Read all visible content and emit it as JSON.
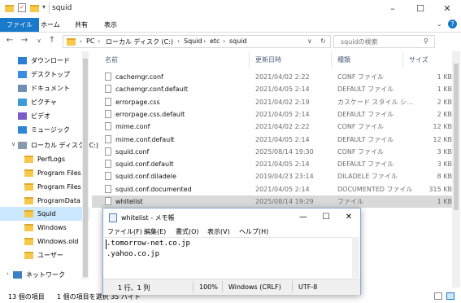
{
  "window": {
    "title": "squid",
    "controls": {
      "minimize": "–",
      "maximize": "☐",
      "close": "✕"
    },
    "help": "?"
  },
  "ribbon": {
    "tabs": [
      "ファイル",
      "ホーム",
      "共有",
      "表示"
    ]
  },
  "address": {
    "crumbs": [
      "PC",
      "ローカル ディスク (C:)",
      "Squid",
      "etc",
      "squid"
    ],
    "search_placeholder": "squidの検索"
  },
  "sidebar": {
    "items": [
      {
        "label": "ダウンロード",
        "icon": "download-icon"
      },
      {
        "label": "デスクトップ",
        "icon": "desktop-icon"
      },
      {
        "label": "ドキュメント",
        "icon": "documents-icon"
      },
      {
        "label": "ピクチャ",
        "icon": "pictures-icon"
      },
      {
        "label": "ビデオ",
        "icon": "video-icon"
      },
      {
        "label": "ミュージック",
        "icon": "music-icon"
      },
      {
        "label": "ローカル ディスク (C:)",
        "icon": "drive-icon"
      },
      {
        "label": "PerfLogs",
        "icon": "folder-icon"
      },
      {
        "label": "Program Files",
        "icon": "folder-icon"
      },
      {
        "label": "Program Files (",
        "icon": "folder-icon"
      },
      {
        "label": "ProgramData",
        "icon": "folder-icon"
      },
      {
        "label": "Squid",
        "icon": "folder-icon",
        "selected": true
      },
      {
        "label": "Windows",
        "icon": "folder-icon"
      },
      {
        "label": "Windows.old",
        "icon": "folder-icon"
      },
      {
        "label": "ユーザー",
        "icon": "folder-icon"
      },
      {
        "label": "ネットワーク",
        "icon": "network-icon"
      }
    ]
  },
  "columns": {
    "name": "名前",
    "date": "更新日時",
    "type": "種類",
    "size": "サイズ"
  },
  "files": [
    {
      "name": "cachemgr.conf",
      "date": "2021/04/02 2:22",
      "type": "CONF ファイル",
      "size": "1 KB"
    },
    {
      "name": "cachemgr.conf.default",
      "date": "2021/04/05 2:14",
      "type": "DEFAULT ファイル",
      "size": "1 KB"
    },
    {
      "name": "errorpage.css",
      "date": "2021/04/02 2:19",
      "type": "カスケード スタイル シ...",
      "size": "2 KB"
    },
    {
      "name": "errorpage.css.default",
      "date": "2021/04/05 2:14",
      "type": "DEFAULT ファイル",
      "size": "2 KB"
    },
    {
      "name": "mime.conf",
      "date": "2021/04/02 2:22",
      "type": "CONF ファイル",
      "size": "12 KB"
    },
    {
      "name": "mime.conf.default",
      "date": "2021/04/05 2:14",
      "type": "DEFAULT ファイル",
      "size": "12 KB"
    },
    {
      "name": "squid.conf",
      "date": "2025/08/14 19:30",
      "type": "CONF ファイル",
      "size": "3 KB"
    },
    {
      "name": "squid.conf.default",
      "date": "2021/04/05 2:14",
      "type": "DEFAULT ファイル",
      "size": "3 KB"
    },
    {
      "name": "squid.conf.diladele",
      "date": "2019/04/23 23:14",
      "type": "DILADELE ファイル",
      "size": "8 KB"
    },
    {
      "name": "squid.conf.documented",
      "date": "2021/04/05 2:14",
      "type": "DOCUMENTED ファイル",
      "size": "315 KB"
    },
    {
      "name": "whitelist",
      "date": "2025/08/14 19:29",
      "type": "ファイル",
      "size": "1 KB",
      "selected": true
    }
  ],
  "status": {
    "count": "13 個の項目",
    "selection": "1 個の項目を選択 35 バイト"
  },
  "notepad": {
    "title": "whitelist - メモ帳",
    "menu": [
      "ファイル(F)",
      "編集(E)",
      "書式(O)",
      "表示(V)",
      "ヘルプ(H)"
    ],
    "lines": [
      ".tomorrow-net.co.jp",
      ".yahoo.co.jp"
    ],
    "status": {
      "position": "1 行、1 列",
      "zoom": "100%",
      "eol": "Windows (CRLF)",
      "encoding": "UTF-8"
    },
    "controls": {
      "minimize": "—",
      "maximize": "☐",
      "close": "✕"
    }
  },
  "colors": {
    "accent": "#1979ca",
    "selection": "#cce8ff"
  }
}
